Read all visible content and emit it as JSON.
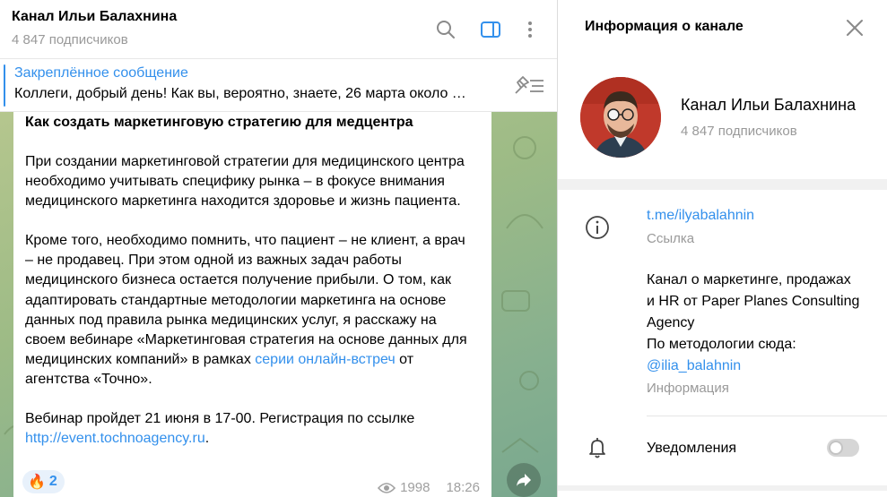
{
  "colors": {
    "accent": "#3390ec",
    "muted": "#999999",
    "wallpaper": "#9dbb86"
  },
  "chat_header": {
    "title": "Канал Ильи Балахнина",
    "subscribers": "4 847 подписчиков",
    "icons": [
      "search-icon",
      "sidebar-toggle-icon",
      "more-vertical-icon"
    ]
  },
  "pinned": {
    "title": "Закреплённое сообщение",
    "text": "Коллеги, добрый день!  Как вы, вероятно, знаете, 26 марта около …",
    "icon": "unpin-list-icon"
  },
  "message": {
    "heading": "Как создать маркетинговую стратегию для медцентра",
    "p1": "При создании маркетинговой стратегии для медицинского центра необходимо учитывать специфику рынка – в фокусе внимания медицинского маркетинга находится здоровье и жизнь пациента.",
    "p2_before": "Кроме того, необходимо помнить, что пациент – не клиент, а врач – не продавец. При этом одной из важных задач работы медицинского бизнеса остается получение прибыли. О том, как адаптировать стандартные методологии маркетинга на основе данных под правила рынка медицинских услуг, я расскажу на своем вебинаре «Маркетинговая стратегия на основе данных для медицинских компаний» в рамках ",
    "p2_link": "серии онлайн-встреч",
    "p2_after": " от агентства «Точно».",
    "p3_text": "Вебинар пройдет 21 июня в 17-00. Регистрация по ссылке ",
    "p3_link": "http://event.tochnoagency.ru",
    "p3_end": ".",
    "reaction_emoji": "🔥",
    "reaction_count": "2",
    "views": "1998",
    "time": "18:26"
  },
  "info_panel": {
    "title": "Информация о канале",
    "channel_name": "Канал Ильи Балахнина",
    "subscribers": "4 847 подписчиков",
    "link": "t.me/ilyabalahnin",
    "link_label": "Ссылка",
    "description": "Канал о маркетинге, продажах и HR от Paper Planes Consulting Agency\nПо методологии сюда:",
    "description_mention": "@ilia_balahnin",
    "description_label": "Информация",
    "notifications_label": "Уведомления",
    "notifications_on": false
  }
}
